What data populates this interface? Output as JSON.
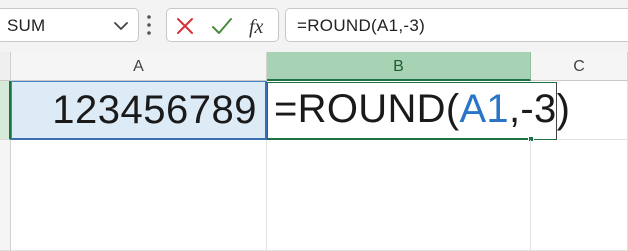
{
  "formula_bar": {
    "name_box": "SUM",
    "formula": "=ROUND(A1,-3)"
  },
  "grid": {
    "columns": [
      "A",
      "B",
      "C"
    ],
    "cells": {
      "A1": "123456789",
      "B1_edit": {
        "prefix": "=ROUND(",
        "ref": "A1",
        "suffix": ",-3)"
      }
    }
  },
  "colors": {
    "accept": "#4a8a3f",
    "cancel": "#d13438",
    "reference": "#2a75c6",
    "active_column": "#a7d3b4"
  },
  "icons": [
    "chevron-down-icon",
    "more-options-icon",
    "cancel-icon",
    "checkmark-icon",
    "fx-icon"
  ]
}
